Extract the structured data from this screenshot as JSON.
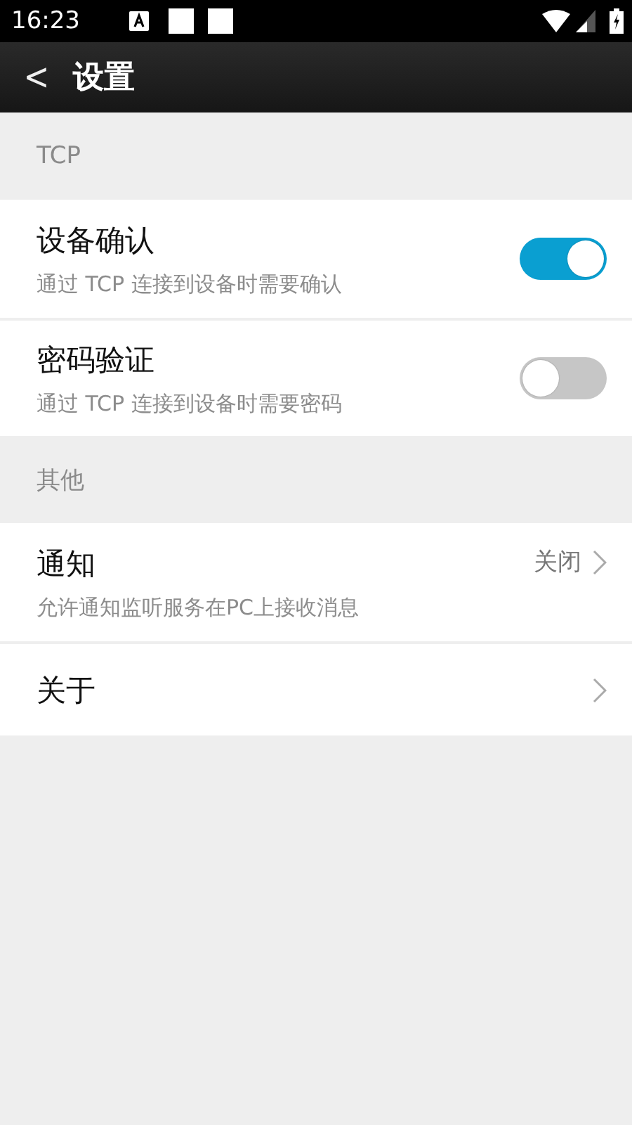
{
  "status_bar": {
    "time": "16:23"
  },
  "app_bar": {
    "back": "<",
    "title": "设置"
  },
  "sections": [
    {
      "header": "TCP",
      "items": [
        {
          "kind": "switch",
          "title": "设备确认",
          "subtitle": "通过 TCP 连接到设备时需要确认",
          "on": true
        },
        {
          "kind": "switch",
          "title": "密码验证",
          "subtitle": "通过 TCP 连接到设备时需要密码",
          "on": false
        }
      ]
    },
    {
      "header": "其他",
      "items": [
        {
          "kind": "link",
          "title": "通知",
          "subtitle": "允许通知监听服务在PC上接收消息",
          "value": "关闭"
        },
        {
          "kind": "link",
          "title": "关于"
        }
      ]
    }
  ]
}
